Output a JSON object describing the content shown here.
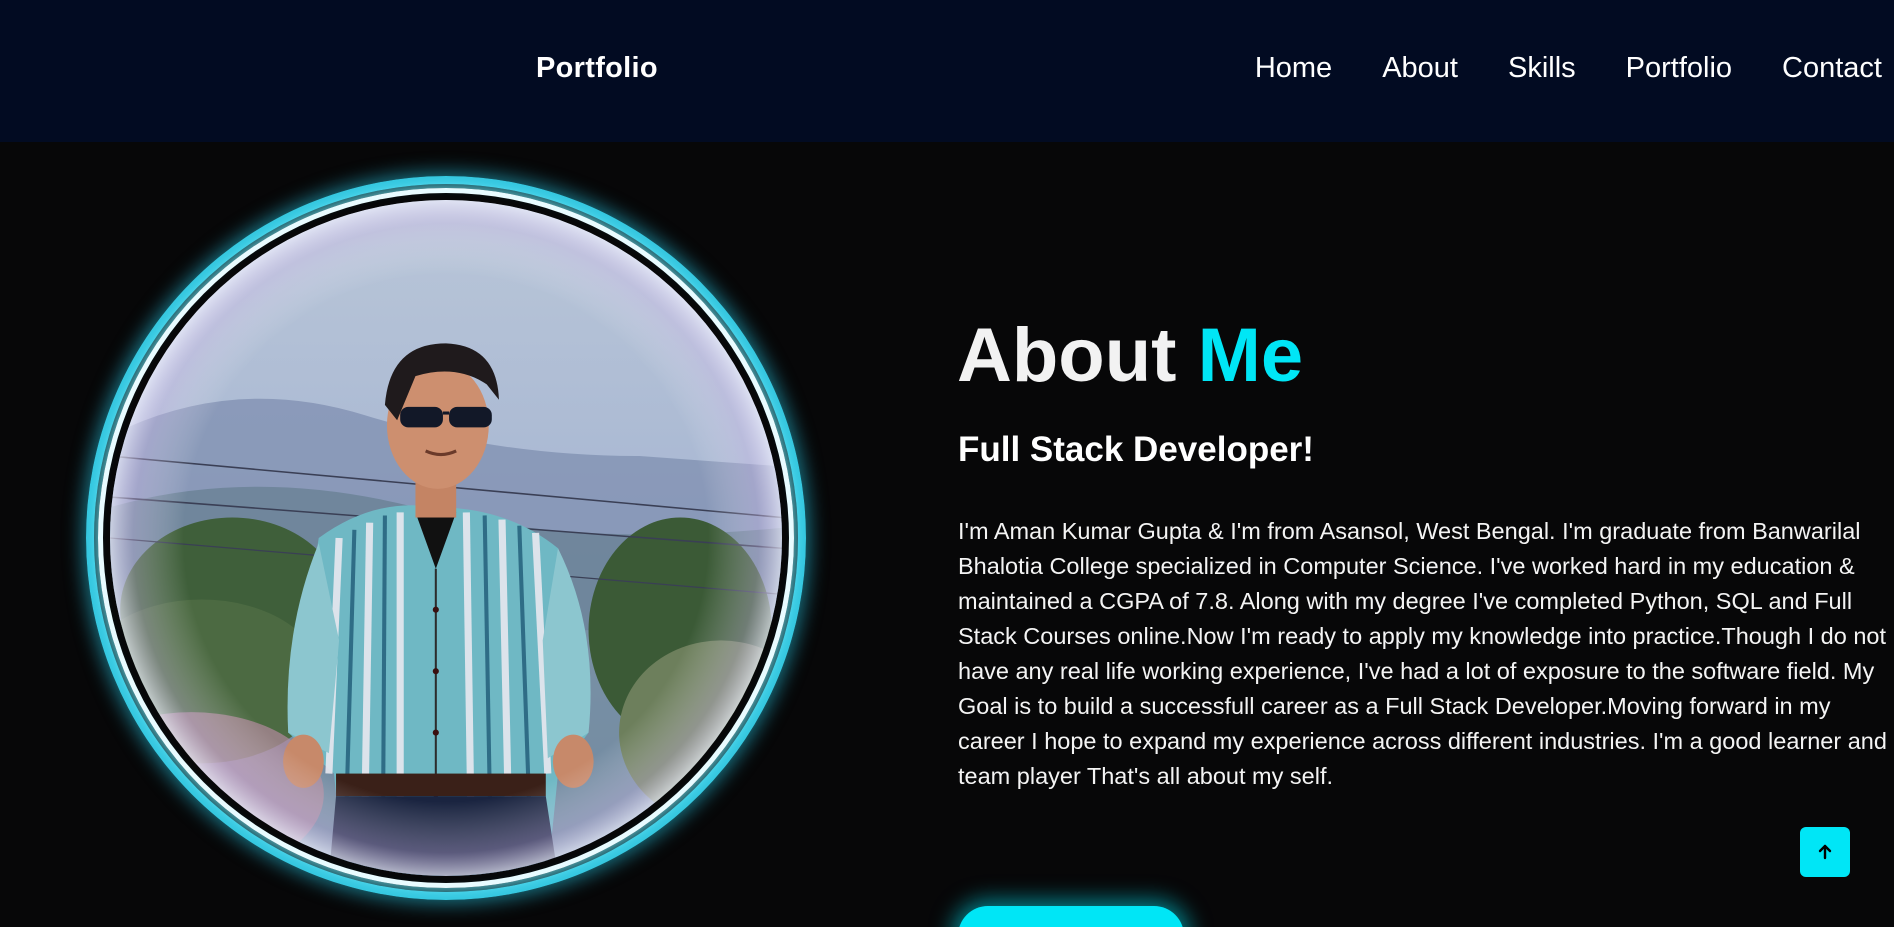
{
  "header": {
    "logo": "Portfolio",
    "nav": [
      {
        "label": "Home"
      },
      {
        "label": "About"
      },
      {
        "label": "Skills"
      },
      {
        "label": "Portfolio"
      },
      {
        "label": "Contact"
      }
    ]
  },
  "about": {
    "title_main": "About",
    "title_accent": "Me",
    "subtitle": "Full Stack Developer!",
    "bio": "I'm Aman Kumar Gupta & I'm from Asansol, West Bengal. I'm graduate from Banwarilal Bhalotia College specialized in Computer Science. I've worked hard in my education & maintained a CGPA of 7.8. Along with my degree I've completed Python, SQL and Full Stack Courses online.Now I'm ready to apply my knowledge into practice.Though I do not have any real life working experience, I've had a lot of exposure to the software field. My Goal is to build a successfull career as a Full Stack Developer.Moving forward in my career I hope to expand my experience across different industries. I'm a good learner and team player That's all about my self."
  },
  "icons": {
    "scroll_top": "arrow-up-icon"
  },
  "colors": {
    "header_bg": "#020b22",
    "page_bg": "#070708",
    "accent": "#00e6f6"
  }
}
